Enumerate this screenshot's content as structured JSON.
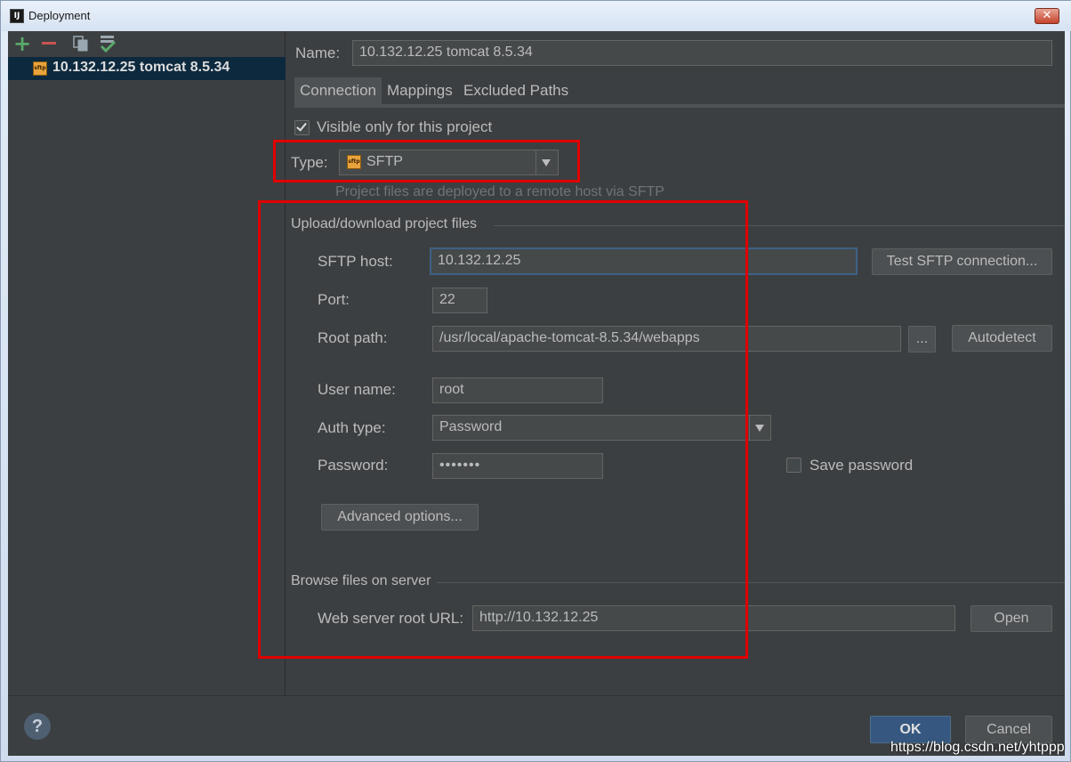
{
  "window": {
    "title": "Deployment",
    "app_icon_text": "IJ",
    "close_glyph": "✕"
  },
  "sidebar": {
    "toolbar": {
      "add": "add-icon",
      "remove": "remove-icon",
      "copy": "copy-icon",
      "default": "set-default-icon"
    },
    "servers": [
      {
        "label": "10.132.12.25 tomcat 8.5.34",
        "icon": "sftp-icon",
        "selected": true
      }
    ]
  },
  "name_field": {
    "label": "Name:",
    "value": "10.132.12.25 tomcat 8.5.34"
  },
  "tabs": [
    {
      "label": "Connection",
      "active": true
    },
    {
      "label": "Mappings",
      "active": false
    },
    {
      "label": "Excluded Paths",
      "active": false
    }
  ],
  "visible_only": {
    "label": "Visible only for this project",
    "checked": true
  },
  "type": {
    "label": "Type:",
    "value": "SFTP",
    "hint": "Project files are deployed to a remote host via SFTP"
  },
  "upload_section": {
    "title": "Upload/download project files",
    "host": {
      "label": "SFTP host:",
      "value": "10.132.12.25"
    },
    "test_button": "Test SFTP connection...",
    "port": {
      "label": "Port:",
      "value": "22"
    },
    "root_path": {
      "label": "Root path:",
      "value": "/usr/local/apache-tomcat-8.5.34/webapps"
    },
    "browse_button": "...",
    "autodetect_button": "Autodetect",
    "user_name": {
      "label": "User name:",
      "value": "root"
    },
    "auth_type": {
      "label": "Auth type:",
      "value": "Password"
    },
    "password": {
      "label": "Password:",
      "value": "•••••••"
    },
    "save_password": {
      "label": "Save password",
      "checked": false
    },
    "advanced_button": "Advanced options..."
  },
  "browse_section": {
    "title": "Browse files on server",
    "web_root": {
      "label": "Web server root URL:",
      "value": "http://10.132.12.25"
    },
    "open_button": "Open"
  },
  "footer": {
    "help": "?",
    "ok": "OK",
    "cancel": "Cancel"
  },
  "watermark": "https://blog.csdn.net/yhtppp",
  "colors": {
    "background": "#3c3f41",
    "selection": "#0d293e",
    "highlight_box": "#e00000",
    "primary_button": "#365880"
  }
}
